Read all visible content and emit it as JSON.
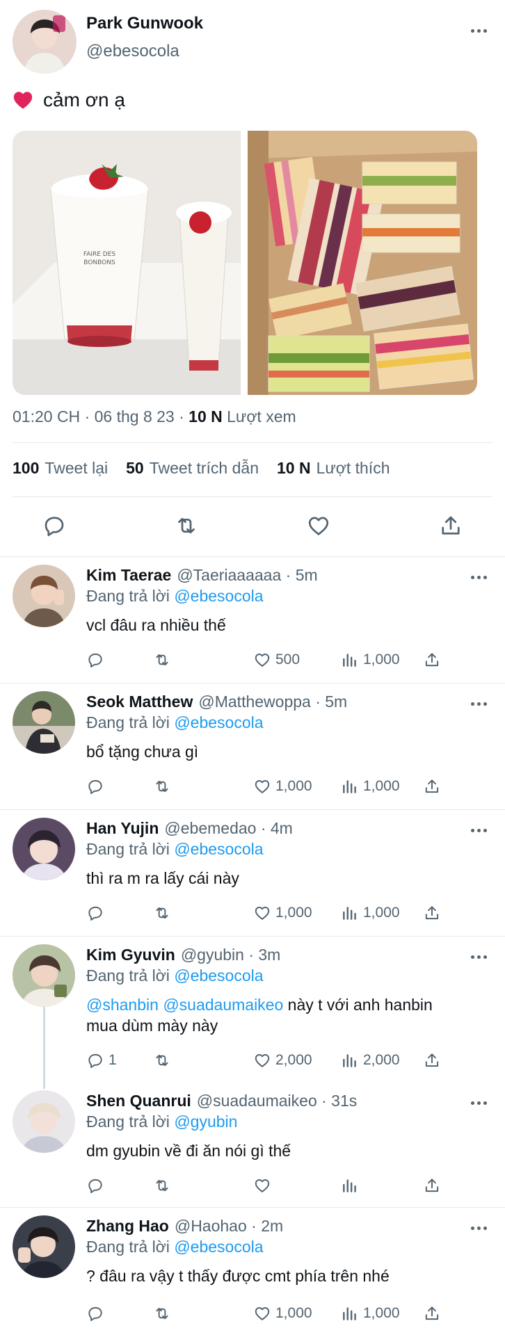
{
  "main_tweet": {
    "author_name": "Park Gunwook",
    "handle": "@ebesocola",
    "text": "cảm ơn ạ",
    "time": "01:20 CH · 06 thg 8 23 ·",
    "views_count": "10 N",
    "views_label": "Lượt xem",
    "retweets_count": "100",
    "retweets_label": "Tweet lại",
    "quotes_count": "50",
    "quotes_label": "Tweet trích dẫn",
    "likes_count": "10 N",
    "likes_label": "Lượt thích"
  },
  "replying_label": "Đang trả lời",
  "replies": [
    {
      "name": "Kim Taerae",
      "handle": "@Taeriaaaaaa · 5m",
      "replying_to": "@ebesocola",
      "text": "vcl đâu ra nhiều thế",
      "reply_count": "",
      "like_count": "500",
      "view_count": "1,000"
    },
    {
      "name": "Seok Matthew",
      "handle": "@Matthewoppa · 5m",
      "replying_to": "@ebesocola",
      "text": "bổ tặng chưa gì",
      "reply_count": "",
      "like_count": "1,000",
      "view_count": "1,000"
    },
    {
      "name": "Han Yujin",
      "handle": "@ebemedao · 4m",
      "replying_to": "@ebesocola",
      "text": "thì ra m ra lấy cái này",
      "reply_count": "",
      "like_count": "1,000",
      "view_count": "1,000"
    },
    {
      "name": "Kim Gyuvin",
      "handle": "@gyubin · 3m",
      "replying_to": "@ebesocola",
      "mention_1": "@shanbin",
      "mention_2": "@suadaumaikeo",
      "text_rest": " này t với anh hanbin",
      "text_line2": "mua dùm mày này",
      "reply_count": "1",
      "like_count": "2,000",
      "view_count": "2,000"
    },
    {
      "name": "Shen Quanrui",
      "handle": "@suadaumaikeo · 31s",
      "replying_to": "@gyubin",
      "text": "dm gyubin về đi ăn nói gì thế",
      "reply_count": "",
      "like_count": "",
      "view_count": ""
    },
    {
      "name": "Zhang Hao",
      "handle": "@Haohao · 2m",
      "replying_to": "@ebesocola",
      "text": "? đâu ra vậy t thấy được cmt phía trên nhé",
      "reply_count": "",
      "like_count": "1,000",
      "view_count": "1,000"
    }
  ],
  "colors": {
    "accent": "#1d9bf0",
    "secondary_text": "#536471",
    "heart_emoji": "#e0245e",
    "divider": "#e6e9ec"
  },
  "icons": [
    "more-icon",
    "reply-icon",
    "retweet-icon",
    "like-icon",
    "views-icon",
    "share-icon",
    "heart-emoji-icon"
  ]
}
